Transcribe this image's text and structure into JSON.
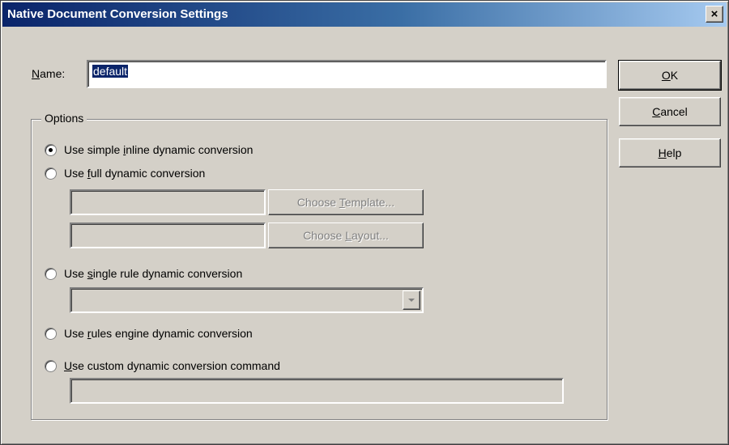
{
  "dialog": {
    "title": "Native Document Conversion Settings",
    "close_glyph": "×"
  },
  "name_field": {
    "label_mnemonic": "N",
    "label_rest": "ame:",
    "value": "default"
  },
  "buttons": {
    "ok": {
      "mnemonic": "O",
      "rest": "K"
    },
    "cancel": {
      "mnemonic": "C",
      "rest": "ancel"
    },
    "help": {
      "mnemonic": "H",
      "rest": "elp"
    }
  },
  "options": {
    "legend": "Options",
    "selected": "simple_inline",
    "simple_inline": {
      "pre": "Use simple ",
      "mnemonic": "i",
      "post": "nline dynamic conversion"
    },
    "full_dynamic": {
      "pre": "Use ",
      "mnemonic": "f",
      "post": "ull dynamic conversion"
    },
    "choose_template": {
      "pre": "Choose ",
      "mnemonic": "T",
      "post": "emplate..."
    },
    "choose_layout": {
      "pre": "Choose ",
      "mnemonic": "L",
      "post": "ayout..."
    },
    "single_rule": {
      "pre": "Use ",
      "mnemonic": "s",
      "post": "ingle rule dynamic conversion"
    },
    "rules_engine": {
      "pre": "Use ",
      "mnemonic": "r",
      "post": "ules engine dynamic conversion"
    },
    "custom_command": {
      "pre": "",
      "mnemonic": "U",
      "post": "se custom dynamic conversion command"
    }
  },
  "icons": {
    "close": "close-icon",
    "dropdown": "chevron-down-icon"
  }
}
